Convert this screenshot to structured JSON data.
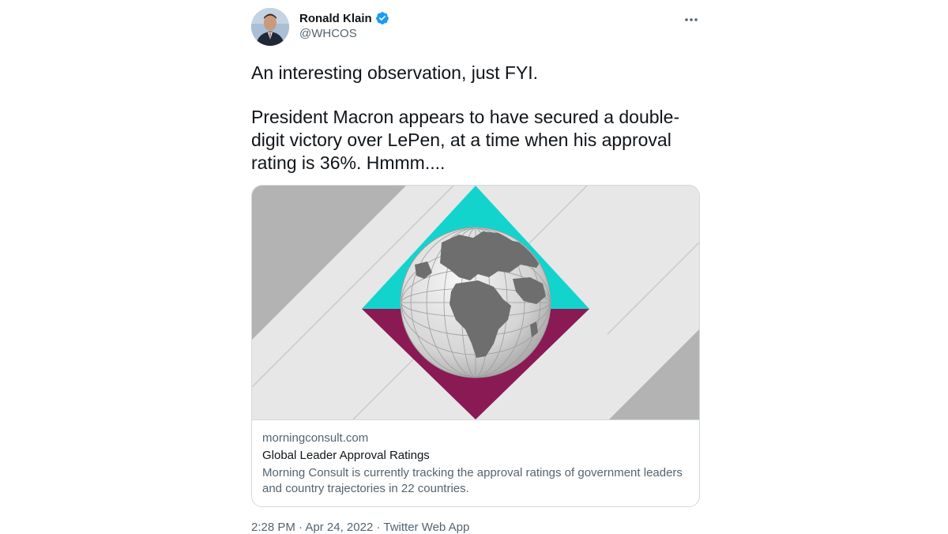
{
  "tweet": {
    "author": {
      "name": "Ronald Klain",
      "handle": "@WHCOS",
      "verified_color": "#1d9bf0"
    },
    "more_icon": "more-horizontal-icon",
    "text": {
      "line1": "An interesting observation, just FYI.",
      "line2": "President Macron appears to have secured a double-digit victory over LePen, at a time when his approval rating is 36%.  Hmmm...."
    },
    "card": {
      "image_icon": "globe-diamond-logo",
      "domain": "morningconsult.com",
      "title": "Global Leader Approval Ratings",
      "description": "Morning Consult is currently tracking the approval ratings of government leaders and country trajectories in 22 countries."
    },
    "meta": {
      "time": "2:28 PM",
      "separator1": " · ",
      "date": "Apr 24, 2022",
      "separator2": " · ",
      "source": "Twitter Web App"
    }
  },
  "colors": {
    "text_primary": "#0f1419",
    "text_secondary": "#536471",
    "border": "#cfd9de",
    "teal": "#13d4cd",
    "maroon": "#8a1a54"
  }
}
